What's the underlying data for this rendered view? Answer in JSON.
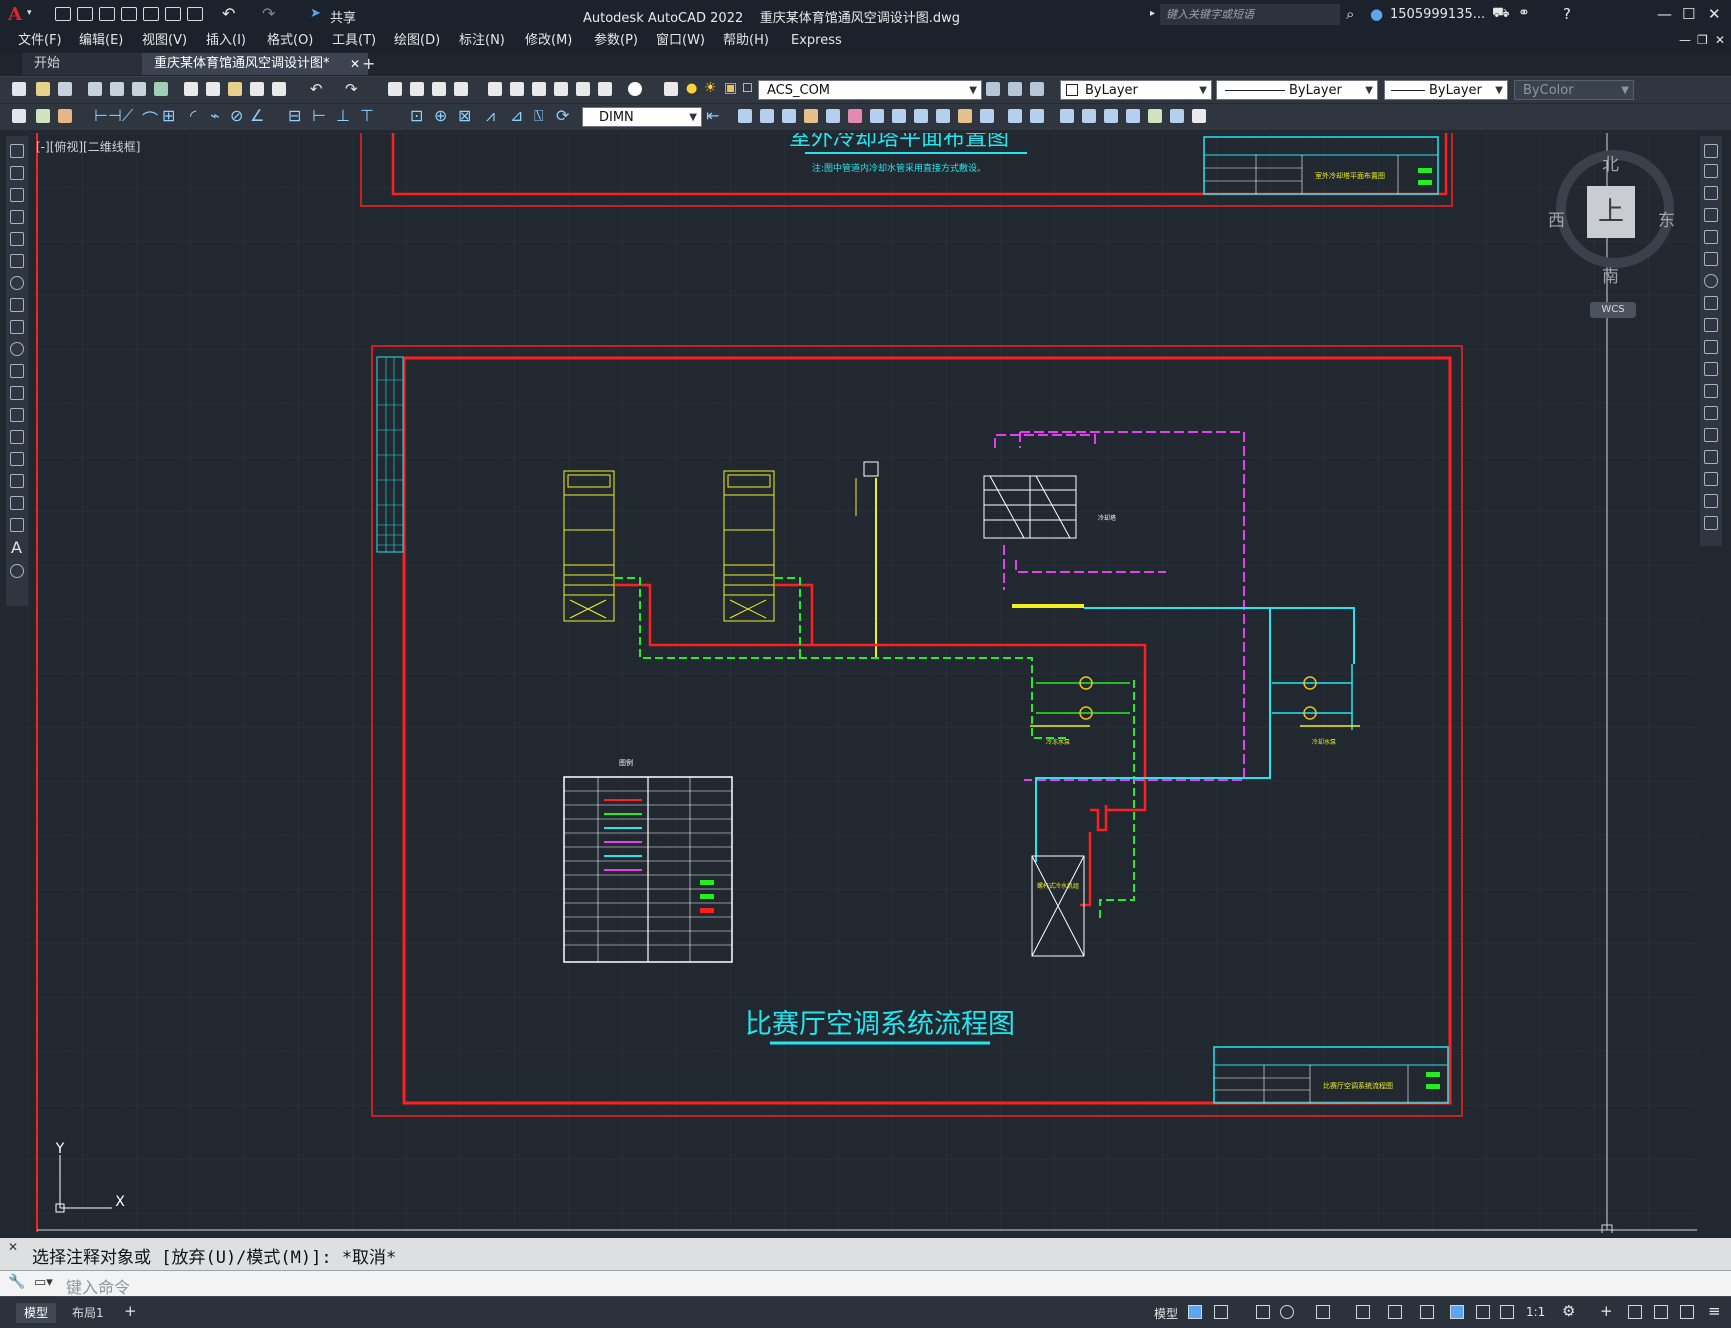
{
  "window": {
    "app_title": "Autodesk AutoCAD 2022    重庆某体育馆通风空调设计图.dwg",
    "search_placeholder": "键入关键字或短语",
    "user": "1505999135...",
    "share_label": "共享",
    "logo": "A"
  },
  "menu": [
    "文件(F)",
    "编辑(E)",
    "视图(V)",
    "插入(I)",
    "格式(O)",
    "工具(T)",
    "绘图(D)",
    "标注(N)",
    "修改(M)",
    "参数(P)",
    "窗口(W)",
    "帮助(H)",
    "Express"
  ],
  "tabs": {
    "start": "开始",
    "drawing": "重庆某体育馆通风空调设计图*",
    "close": "✕",
    "add": "+"
  },
  "toolbar": {
    "text_style": "ACS_COM",
    "dim_style": "DIMN",
    "color": "ByLayer",
    "linetype": "ByLayer",
    "lineweight": "ByLayer",
    "plotstyle": "ByColor"
  },
  "viewport": {
    "label": "[-][俯视][二维线框]"
  },
  "viewcube": {
    "north": "北",
    "south": "南",
    "east": "东",
    "west": "西",
    "face": "上",
    "wcs": "WCS"
  },
  "drawing": {
    "top_title": "室外冷却塔平面布置图",
    "top_note": "注:图中管道内冷却水管采用直接方式敷设。",
    "main_title": "比赛厅空调系统流程图",
    "title_block_top": "室外冷却塔平面布置图",
    "title_block_main": "比赛厅空调系统流程图",
    "cooling_tower_label": "冷却塔",
    "pump_label_1": "冷冻水泵",
    "pump_label_2": "冷却水泵",
    "chiller_label": "螺杆式冷水机组",
    "legend_title": "图例",
    "ucs_x": "X",
    "ucs_y": "Y"
  },
  "colors": {
    "red": "#ff1f1f",
    "cyan": "#22e6f0",
    "green": "#22ee22",
    "magenta": "#e13ff0",
    "yellow": "#f0f022",
    "white": "#ffffff",
    "canvas": "#212830"
  },
  "command": {
    "history": "选择注释对象或 [放弃(U)/模式(M)]: *取消*",
    "placeholder": "键入命令"
  },
  "status": {
    "model_tab": "模型",
    "layout_tab": "布局1",
    "model_button": "模型",
    "scale": "1:1"
  }
}
